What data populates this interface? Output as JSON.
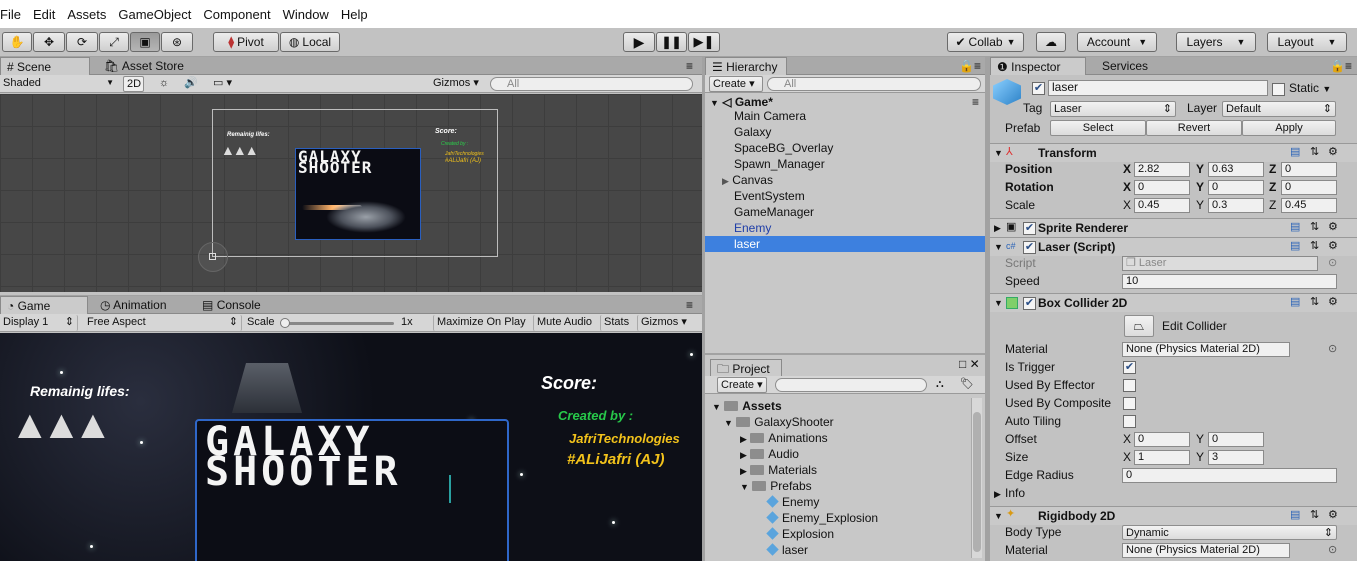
{
  "menu": [
    "File",
    "Edit",
    "Assets",
    "GameObject",
    "Component",
    "Window",
    "Help"
  ],
  "toolbar": {
    "pivot": "Pivot",
    "local": "Local",
    "collab": "Collab",
    "account": "Account",
    "layers": "Layers",
    "layout": "Layout"
  },
  "scene": {
    "tab_scene": "Scene",
    "tab_store": "Asset Store",
    "shading": "Shaded",
    "mode_2d": "2D",
    "gizmos": "Gizmos",
    "search_placeholder": "All",
    "remain": "Remainig lifes:",
    "score": "Score:",
    "created": "Created by :",
    "author1": "JafriTechnologies",
    "author2": "#ALiJafri (AJ)",
    "title1": "GALAXY",
    "title2": "SHOOTER"
  },
  "game": {
    "tab_game": "Game",
    "tab_animation": "Animation",
    "tab_console": "Console",
    "display": "Display 1",
    "aspect": "Free Aspect",
    "scale_label": "Scale",
    "scale_value": "1x",
    "maximize": "Maximize On Play",
    "mute": "Mute Audio",
    "stats": "Stats",
    "gizmos": "Gizmos",
    "remain": "Remainig lifes:",
    "score": "Score:",
    "created": "Created by :",
    "author1": "JafriTechnologies",
    "author2": "#ALiJafri (AJ)",
    "title1": "GALAXY",
    "title2": "SHOOTER"
  },
  "hierarchy": {
    "tab": "Hierarchy",
    "create": "Create",
    "search_placeholder": "All",
    "scene_name": "Game*",
    "items": [
      "Main Camera",
      "Galaxy",
      "SpaceBG_Overlay",
      "Spawn_Manager",
      "Canvas",
      "EventSystem",
      "GameManager",
      "Enemy",
      "laser"
    ]
  },
  "project": {
    "tab": "Project",
    "create": "Create",
    "root": "Assets",
    "folder": "GalaxyShooter",
    "subfolders": [
      "Animations",
      "Audio",
      "Materials",
      "Prefabs"
    ],
    "prefabs": [
      "Enemy",
      "Enemy_Explosion",
      "Explosion",
      "laser"
    ]
  },
  "inspector": {
    "tab": "Inspector",
    "tab_services": "Services",
    "object_name": "laser",
    "static_label": "Static",
    "tag_label": "Tag",
    "tag_value": "Laser",
    "layer_label": "Layer",
    "layer_value": "Default",
    "prefab_label": "Prefab",
    "select": "Select",
    "revert": "Revert",
    "apply": "Apply",
    "transform": {
      "title": "Transform",
      "position": "Position",
      "rotation": "Rotation",
      "scale": "Scale",
      "pos": [
        "2.82",
        "0.63",
        "0"
      ],
      "rot": [
        "0",
        "0",
        "0"
      ],
      "scl": [
        "0.45",
        "0.3",
        "0.45"
      ]
    },
    "sprite_renderer": "Sprite Renderer",
    "laser_script": {
      "title": "Laser (Script)",
      "script_label": "Script",
      "script_value": "Laser",
      "speed_label": "Speed",
      "speed_value": "10"
    },
    "box_collider": {
      "title": "Box Collider 2D",
      "edit": "Edit Collider",
      "material_label": "Material",
      "material_value": "None (Physics Material 2D)",
      "is_trigger": "Is Trigger",
      "used_effector": "Used By Effector",
      "used_composite": "Used By Composite",
      "auto_tiling": "Auto Tiling",
      "offset": "Offset",
      "offset_x": "0",
      "offset_y": "0",
      "size": "Size",
      "size_x": "1",
      "size_y": "3",
      "edge_radius": "Edge Radius",
      "edge_value": "0",
      "info": "Info"
    },
    "rigidbody": {
      "title": "Rigidbody 2D",
      "body_type_label": "Body Type",
      "body_type_value": "Dynamic",
      "material_label": "Material",
      "material_value": "None (Physics Material 2D)"
    }
  },
  "axis_labels": {
    "x": "X",
    "y": "Y",
    "z": "Z"
  },
  "colors": {
    "selection": "#3d80df",
    "accent_blue": "#1f3ea8",
    "score_yellow": "#f2c21b",
    "created_green": "#27c94a"
  }
}
